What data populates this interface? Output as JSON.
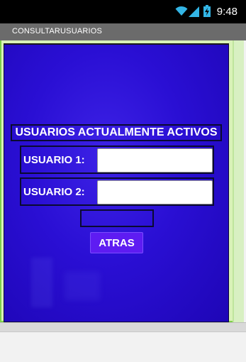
{
  "status_bar": {
    "time": "9:48",
    "icons": [
      "wifi-icon",
      "signal-icon",
      "battery-charging-icon"
    ]
  },
  "title_bar": {
    "title": "CONSULTARUSUARIOS"
  },
  "form": {
    "heading": "USUARIOS ACTUALMENTE ACTIVOS",
    "user1_label": "USUARIO 1:",
    "user1_value": "",
    "user2_label": "USUARIO 2:",
    "user2_value": "",
    "result_text": "",
    "back_button": "ATRAS"
  },
  "colors": {
    "background": "#2a0fd4",
    "button": "#5e1cf2",
    "frame_border": "#7ed04b"
  }
}
